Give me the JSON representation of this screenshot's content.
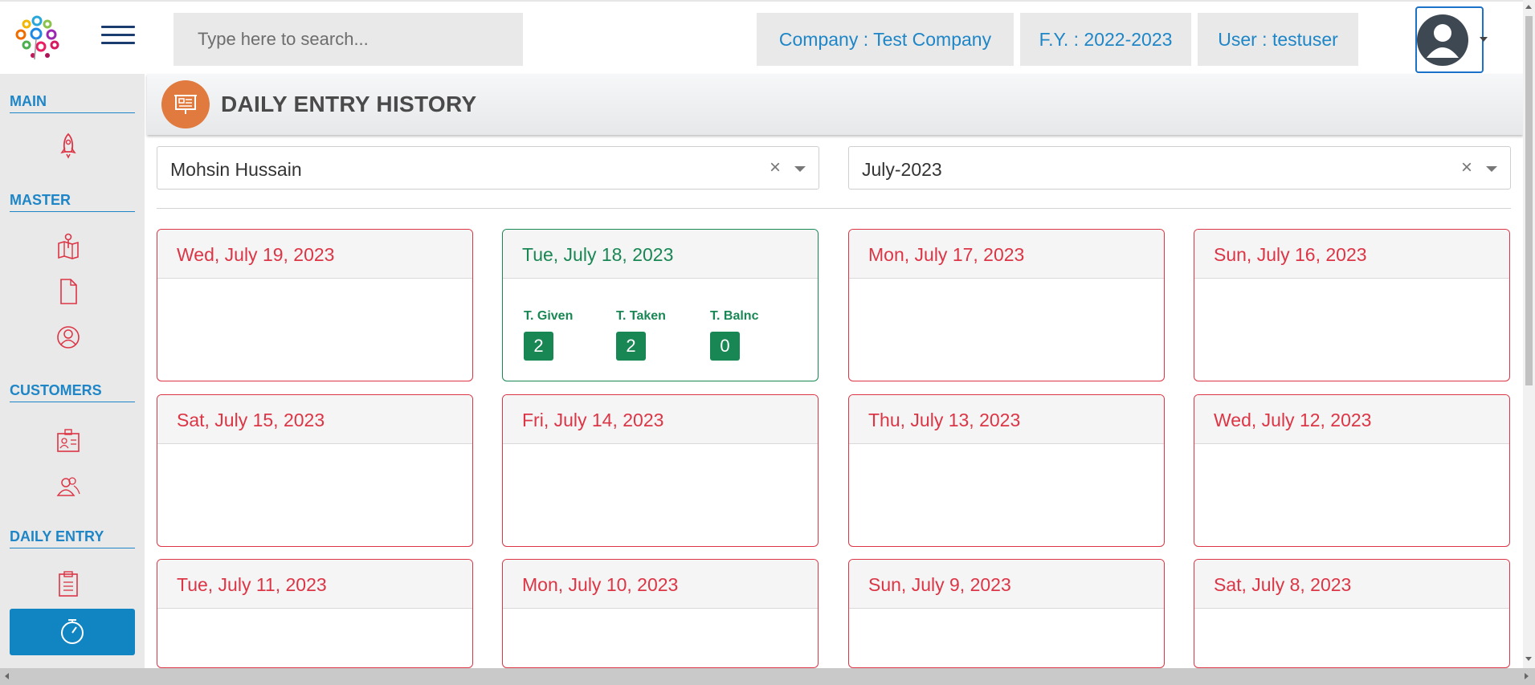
{
  "search": {
    "placeholder": "Type here to search..."
  },
  "header": {
    "company": "Company : Test Company",
    "fy": "F.Y. : 2022-2023",
    "user": "User : testuser"
  },
  "sidebar": {
    "sections": [
      "MAIN",
      "MASTER",
      "CUSTOMERS",
      "DAILY ENTRY"
    ]
  },
  "page": {
    "title": "DAILY ENTRY HISTORY"
  },
  "filters": {
    "person": "Mohsin Hussain",
    "month": "July-2023",
    "clear_symbol": "×"
  },
  "stat_labels": {
    "given": "T. Given",
    "taken": "T. Taken",
    "balance": "T. Balnc"
  },
  "cards": [
    {
      "date": "Wed, July 19, 2023"
    },
    {
      "date": "Tue, July 18, 2023",
      "given": "2",
      "taken": "2",
      "balance": "0"
    },
    {
      "date": "Mon, July 17, 2023"
    },
    {
      "date": "Sun, July 16, 2023"
    },
    {
      "date": "Sat, July 15, 2023"
    },
    {
      "date": "Fri, July 14, 2023"
    },
    {
      "date": "Thu, July 13, 2023"
    },
    {
      "date": "Wed, July 12, 2023"
    },
    {
      "date": "Tue, July 11, 2023"
    },
    {
      "date": "Mon, July 10, 2023"
    },
    {
      "date": "Sun, July 9, 2023"
    },
    {
      "date": "Sat, July 8, 2023"
    }
  ],
  "colors": {
    "accent": "#1e86c6",
    "empty_day": "#dc3545",
    "entry_day": "#198754",
    "header_icon": "#e07a3f"
  }
}
